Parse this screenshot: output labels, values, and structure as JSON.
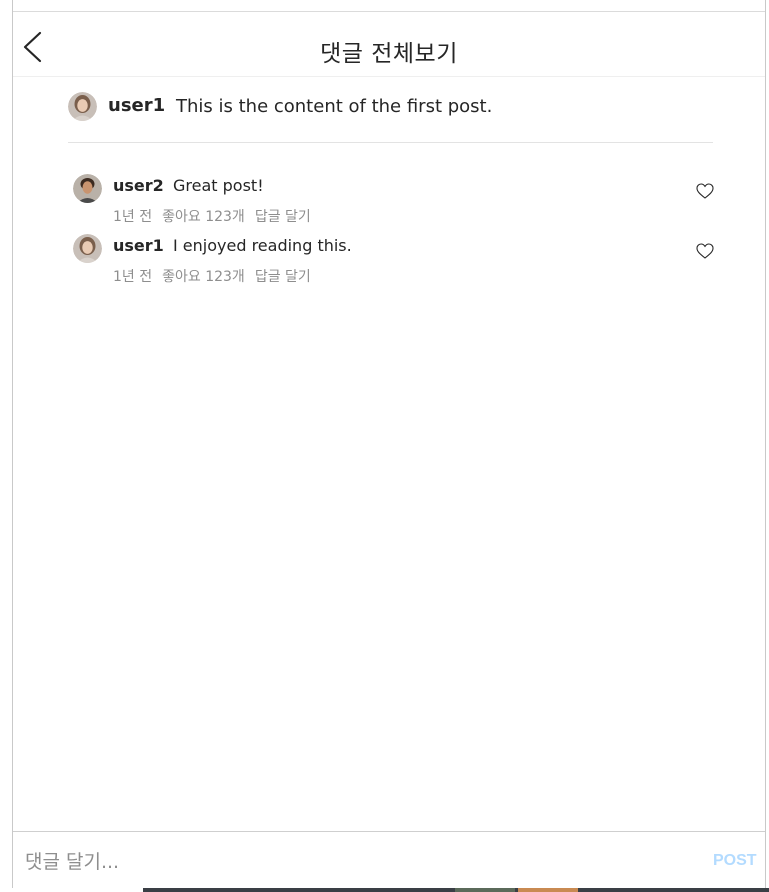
{
  "header": {
    "title": "댓글 전체보기",
    "back_icon": "chevron-left-icon"
  },
  "post": {
    "username": "user1",
    "content": "This is the content of the first post."
  },
  "comments": [
    {
      "username": "user2",
      "text": "Great post!",
      "time": "1년 전",
      "likes": "좋아요 123개",
      "reply": "답글 달기",
      "like_icon": "heart-outline-icon"
    },
    {
      "username": "user1",
      "text": "I enjoyed reading this.",
      "time": "1년 전",
      "likes": "좋아요 123개",
      "reply": "답글 달기",
      "like_icon": "heart-outline-icon"
    }
  ],
  "composer": {
    "placeholder": "댓글 달기...",
    "value": "",
    "post_label": "POST"
  },
  "colors": {
    "text": "#262626",
    "muted": "#8e8e8e",
    "post_button_disabled": "#b3dbff",
    "divider": "#efefef"
  }
}
